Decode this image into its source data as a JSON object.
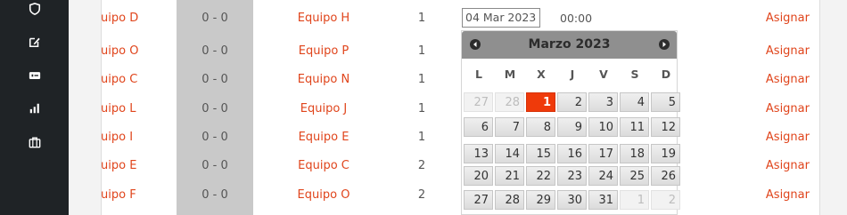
{
  "sidebar": {
    "icons": [
      {
        "name": "shield-icon"
      },
      {
        "name": "edit-icon"
      },
      {
        "name": "ticket-icon"
      },
      {
        "name": "bar-chart-icon"
      },
      {
        "name": "briefcase-icon"
      }
    ]
  },
  "table": {
    "rows": [
      {
        "team1": "uipo D",
        "score": "0 - 0",
        "team2": "Equipo H",
        "num": "1",
        "assign": "Asignar"
      },
      {
        "team1": "uipo O",
        "score": "0 - 0",
        "team2": "Equipo P",
        "num": "1",
        "assign": "Asignar"
      },
      {
        "team1": "uipo C",
        "score": "0 - 0",
        "team2": "Equipo N",
        "num": "1",
        "assign": "Asignar"
      },
      {
        "team1": "uipo L",
        "score": "0 - 0",
        "team2": "Equipo J",
        "num": "1",
        "assign": "Asignar"
      },
      {
        "team1": "uipo I",
        "score": "0 - 0",
        "team2": "Equipo E",
        "num": "1",
        "assign": "Asignar"
      },
      {
        "team1": "uipo E",
        "score": "0 - 0",
        "team2": "Equipo C",
        "num": "2",
        "assign": "Asignar"
      },
      {
        "team1": "uipo F",
        "score": "0 - 0",
        "team2": "Equipo O",
        "num": "2",
        "assign": "Asignar"
      }
    ]
  },
  "date_input": {
    "value": "04 Mar 2023"
  },
  "time": {
    "value": "00:00"
  },
  "calendar": {
    "title": "Marzo 2023",
    "weekdays": [
      "L",
      "M",
      "X",
      "J",
      "V",
      "S",
      "D"
    ],
    "weeks": [
      [
        {
          "d": "27",
          "other": true
        },
        {
          "d": "28",
          "other": true
        },
        {
          "d": "1",
          "selected": true
        },
        {
          "d": "2"
        },
        {
          "d": "3"
        },
        {
          "d": "4"
        },
        {
          "d": "5"
        }
      ],
      [
        {
          "d": "6"
        },
        {
          "d": "7"
        },
        {
          "d": "8"
        },
        {
          "d": "9"
        },
        {
          "d": "10"
        },
        {
          "d": "11"
        },
        {
          "d": "12"
        }
      ],
      [
        {
          "d": "13"
        },
        {
          "d": "14"
        },
        {
          "d": "15"
        },
        {
          "d": "16"
        },
        {
          "d": "17"
        },
        {
          "d": "18"
        },
        {
          "d": "19"
        }
      ],
      [
        {
          "d": "20"
        },
        {
          "d": "21"
        },
        {
          "d": "22"
        },
        {
          "d": "23"
        },
        {
          "d": "24"
        },
        {
          "d": "25"
        },
        {
          "d": "26"
        }
      ],
      [
        {
          "d": "27"
        },
        {
          "d": "28"
        },
        {
          "d": "29"
        },
        {
          "d": "30"
        },
        {
          "d": "31"
        },
        {
          "d": "1",
          "other": true
        },
        {
          "d": "2",
          "other": true
        }
      ]
    ]
  },
  "colors": {
    "accent": "#e0451c",
    "selected_day": "#ef3a0a",
    "sidebar": "#1f2326"
  }
}
